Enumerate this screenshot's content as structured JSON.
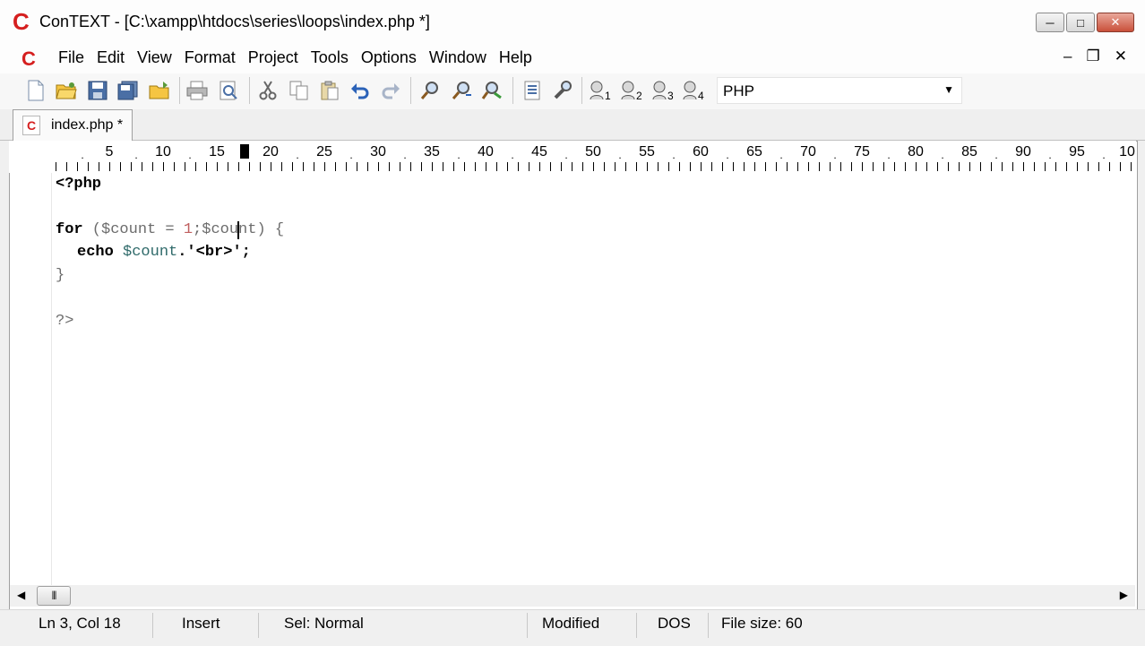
{
  "window": {
    "title": "ConTEXT - [C:\\xampp\\htdocs\\series\\loops\\index.php *]",
    "app_logo": "C",
    "minimize": "─",
    "maximize": "□",
    "close": "✕"
  },
  "menu": {
    "doc_icon": "C",
    "items": [
      "File",
      "Edit",
      "View",
      "Format",
      "Project",
      "Tools",
      "Options",
      "Window",
      "Help"
    ],
    "mdi_minimize": "–",
    "mdi_restore": "❐",
    "mdi_close": "✕"
  },
  "toolbar": {
    "icons": [
      "new-file-icon",
      "open-folder-icon",
      "save-icon",
      "save-all-icon",
      "open-project-icon",
      "print-icon",
      "print-preview-icon",
      "cut-icon",
      "copy-icon",
      "paste-icon",
      "undo-icon",
      "redo-icon",
      "find-icon",
      "find-next-icon",
      "replace-icon",
      "file-compare-icon",
      "tools-icon",
      "user-command-1-icon",
      "user-command-2-icon",
      "user-command-3-icon",
      "user-command-4-icon"
    ],
    "language": "PHP"
  },
  "tab": {
    "icon": "C",
    "label": "index.php *"
  },
  "ruler": {
    "numbers": [
      "5",
      "10",
      "15",
      "20",
      "25",
      "30",
      "35",
      "40",
      "45",
      "50",
      "55",
      "60",
      "65",
      "70",
      "75",
      "80",
      "85",
      "90",
      "95",
      "10"
    ],
    "dot": "."
  },
  "code": {
    "line1": "<?php",
    "line3_kw": "for",
    "line3_a": " (",
    "line3_var1": "$count",
    "line3_b": " = ",
    "line3_num": "1",
    "line3_c": ";",
    "line3_var2": "$count",
    "line3_d": ") {",
    "line4_kw": "echo",
    "line4_var": " $count",
    "line4_rest": ".'<br>';",
    "line5": "}",
    "line7": "?>"
  },
  "scroll": {
    "left": "◀",
    "thumb": "|||",
    "right": "▶"
  },
  "status": {
    "position": "Ln 3, Col 18",
    "mode": "Insert",
    "selection": "Sel: Normal",
    "modified": "Modified",
    "line_endings": "DOS",
    "file_size": "File size: 60"
  }
}
